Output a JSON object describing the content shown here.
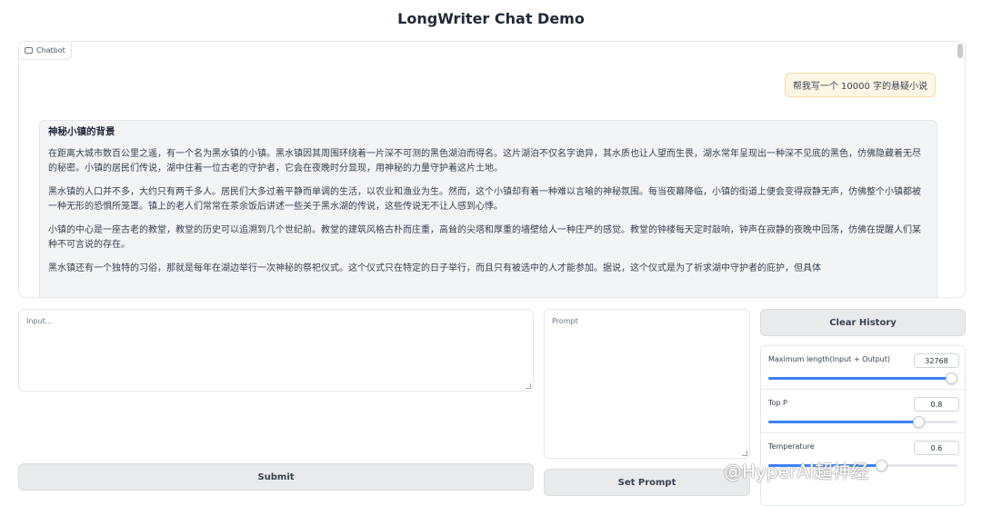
{
  "app": {
    "title": "LongWriter Chat Demo"
  },
  "chatbot": {
    "label": "Chatbot",
    "user_message": "帮我写一个 10000 字的悬疑小说",
    "bot_heading": "神秘小镇的背景",
    "bot_paragraphs": [
      "在距离大城市数百公里之遥，有一个名为黑水镇的小镇。黑水镇因其周围环绕着一片深不可测的黑色湖泊而得名。这片湖泊不仅名字诡异，其水质也让人望而生畏，湖水常年呈现出一种深不见底的黑色，仿佛隐藏着无尽的秘密。小镇的居民们传说，湖中住着一位古老的守护者，它会在夜晚时分显现，用神秘的力量守护着这片土地。",
      "黑水镇的人口并不多，大约只有两千多人。居民们大多过着平静而单调的生活，以农业和渔业为生。然而，这个小镇却有着一种难以言喻的神秘氛围。每当夜幕降临，小镇的街道上便会变得寂静无声，仿佛整个小镇都被一种无形的恐惧所笼罩。镇上的老人们常常在茶余饭后讲述一些关于黑水湖的传说，这些传说无不让人感到心悸。",
      "小镇的中心是一座古老的教堂，教堂的历史可以追溯到几个世纪前。教堂的建筑风格古朴而庄重，高耸的尖塔和厚重的墙壁给人一种庄严的感觉。教堂的钟楼每天定时敲响，钟声在寂静的夜晚中回荡，仿佛在提醒人们某种不可言说的存在。",
      "黑水镇还有一个独特的习俗，那就是每年在湖边举行一次神秘的祭祀仪式。这个仪式只在特定的日子举行，而且只有被选中的人才能参加。据说，这个仪式是为了祈求湖中守护者的庇护，但具体"
    ]
  },
  "input": {
    "placeholder": "Input..."
  },
  "prompt": {
    "placeholder": "Prompt"
  },
  "buttons": {
    "submit": "Submit",
    "set_prompt": "Set Prompt",
    "clear_history": "Clear History"
  },
  "sliders": [
    {
      "label": "Maximum length(Input + Output)",
      "value": "32768",
      "fraction": 1.0
    },
    {
      "label": "Top P",
      "value": "0.8",
      "fraction": 0.8
    },
    {
      "label": "Temperature",
      "value": "0.6",
      "fraction": 0.6
    }
  ],
  "watermark": "@HyperAI超神经",
  "colors": {
    "accent": "#3b82f6",
    "user_bubble": "#fff7e6",
    "bot_bubble": "#f3f4f6",
    "button": "#e9eaec"
  }
}
